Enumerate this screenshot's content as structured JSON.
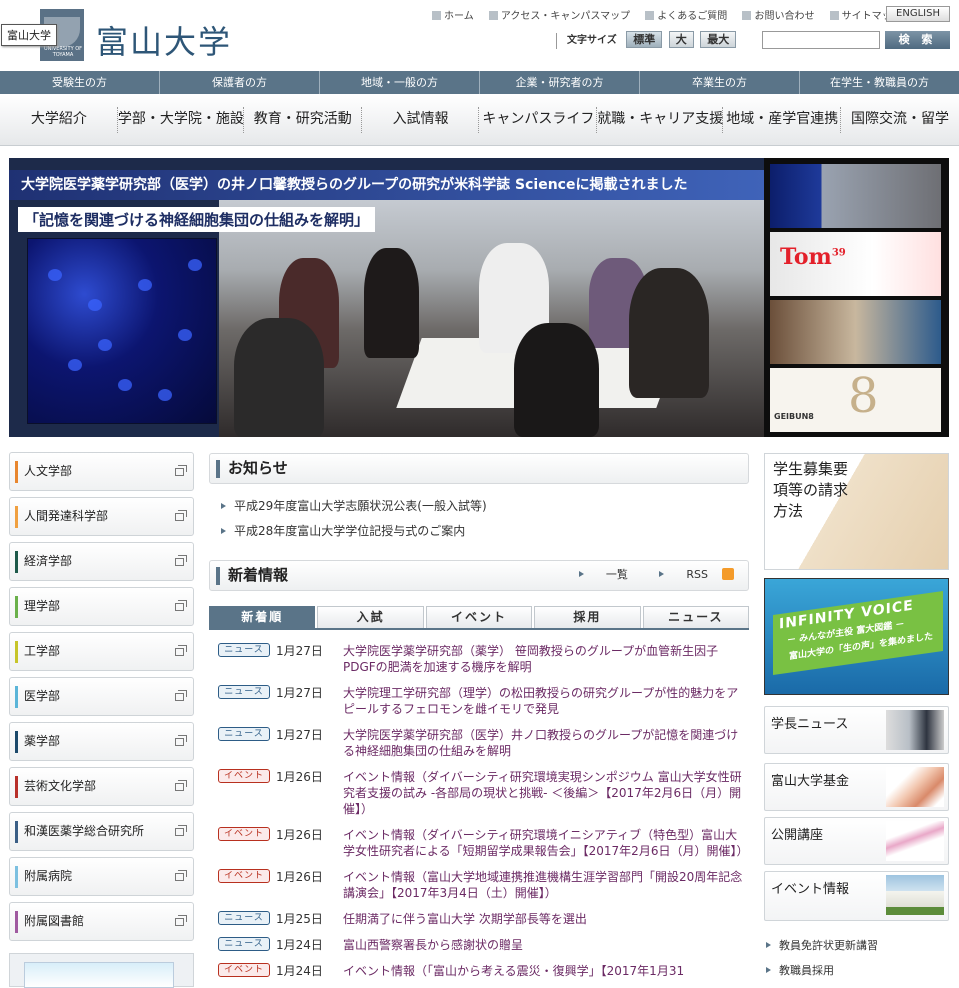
{
  "header": {
    "logo_name": "富山大学",
    "logo_small": "UNIVERSITY OF TOYAMA",
    "tooltip": "富山大学",
    "utility_links": [
      "ホーム",
      "アクセス・キャンパスマップ",
      "よくあるご質問",
      "お問い合わせ",
      "サイトマップ"
    ],
    "english": "ENGLISH",
    "font_size_label": "文字サイズ",
    "font_sizes": [
      "標準",
      "大",
      "最大"
    ],
    "search_button": "検 索",
    "search_placeholder": ""
  },
  "audience_nav": [
    "受験生の方",
    "保護者の方",
    "地域・一般の方",
    "企業・研究者の方",
    "卒業生の方",
    "在学生・教職員の方"
  ],
  "main_nav": [
    "大学紹介",
    "学部・大学院・施設",
    "教育・研究活動",
    "入試情報",
    "キャンパスライフ",
    "就職・キャリア支援",
    "地域・産学官連携",
    "国際交流・留学"
  ],
  "banner": {
    "headline": "大学院医学薬学研究部（医学）の井ノ口馨教授らのグループの研究が米科学誌 Scienceに掲載されました",
    "subhead": "「記憶を関連づける神経細胞集団の仕組みを解明」"
  },
  "thumbs": {
    "tom": "Tom",
    "tom_no": "39",
    "geibun": "GEIBUN8",
    "eight": "8"
  },
  "faculties": [
    {
      "label": "人文学部",
      "color": "#e8862e"
    },
    {
      "label": "人間発達科学部",
      "color": "#f0a040"
    },
    {
      "label": "経済学部",
      "color": "#1e5a4a"
    },
    {
      "label": "理学部",
      "color": "#6ab04a"
    },
    {
      "label": "工学部",
      "color": "#c7c52a"
    },
    {
      "label": "医学部",
      "color": "#5bb5d8"
    },
    {
      "label": "薬学部",
      "color": "#1d4a6b"
    },
    {
      "label": "芸術文化学部",
      "color": "#b8302a"
    },
    {
      "label": "和漢医薬学総合研究所",
      "color": "#3b5f86"
    },
    {
      "label": "附属病院",
      "color": "#7cc0e0"
    },
    {
      "label": "附属図書館",
      "color": "#a05aa0"
    }
  ],
  "notice": {
    "title": "お知らせ",
    "items": [
      "平成29年度富山大学志願状況公表(一般入試等)",
      "平成28年度富山大学学位記授与式のご案内"
    ]
  },
  "news": {
    "title": "新着情報",
    "list_link": "一覧",
    "rss": "RSS",
    "tabs": [
      "新着順",
      "入試",
      "イベント",
      "採用",
      "ニュース"
    ],
    "items": [
      {
        "type": "news",
        "badge": "ニュース",
        "date": "1月27日",
        "text": "大学院医学薬学研究部（薬学） 笹岡教授らのグループが血管新生因子PDGFの肥満を加速する機序を解明"
      },
      {
        "type": "news",
        "badge": "ニュース",
        "date": "1月27日",
        "text": "大学院理工学研究部（理学）の松田教授らの研究グループが性的魅力をアピールするフェロモンを雌イモリで発見"
      },
      {
        "type": "news",
        "badge": "ニュース",
        "date": "1月27日",
        "text": "大学院医学薬学研究部（医学）井ノ口教授らのグループが記憶を関連づける神経細胞集団の仕組みを解明"
      },
      {
        "type": "event",
        "badge": "イベント",
        "date": "1月26日",
        "text": "イベント情報（ダイバーシティ研究環境実現シンポジウム 富山大学女性研究者支援の試み -各部局の現状と挑戦- ＜後編＞【2017年2月6日（月）開催】）"
      },
      {
        "type": "event",
        "badge": "イベント",
        "date": "1月26日",
        "text": "イベント情報（ダイバーシティ研究環境イニシアティブ（特色型）富山大学女性研究者による「短期留学成果報告会」【2017年2月6日（月）開催】）"
      },
      {
        "type": "event",
        "badge": "イベント",
        "date": "1月26日",
        "text": "イベント情報（富山大学地域連携推進機構生涯学習部門「開設20周年記念講演会」【2017年3月4日（土）開催】）"
      },
      {
        "type": "news",
        "badge": "ニュース",
        "date": "1月25日",
        "text": "任期満了に伴う富山大学 次期学部長等を選出"
      },
      {
        "type": "news",
        "badge": "ニュース",
        "date": "1月24日",
        "text": "富山西警察署長から感謝状の贈呈"
      },
      {
        "type": "event",
        "badge": "イベント",
        "date": "1月24日",
        "text": "イベント情報（「富山から考える震災・復興学」【2017年1月31"
      }
    ]
  },
  "sidebar": {
    "recruit": "学生募集要項等の請求方法",
    "infinity_title": "INFINITY VOICE",
    "infinity_sub1": "－ みんなが主役 富大図鑑 －",
    "infinity_sub2": "富山大学の「生の声」を集めました",
    "boxes": [
      "学長ニュース",
      "富山大学基金",
      "公開講座",
      "イベント情報"
    ],
    "links": [
      "教員免許状更新講習",
      "教職員採用"
    ]
  }
}
